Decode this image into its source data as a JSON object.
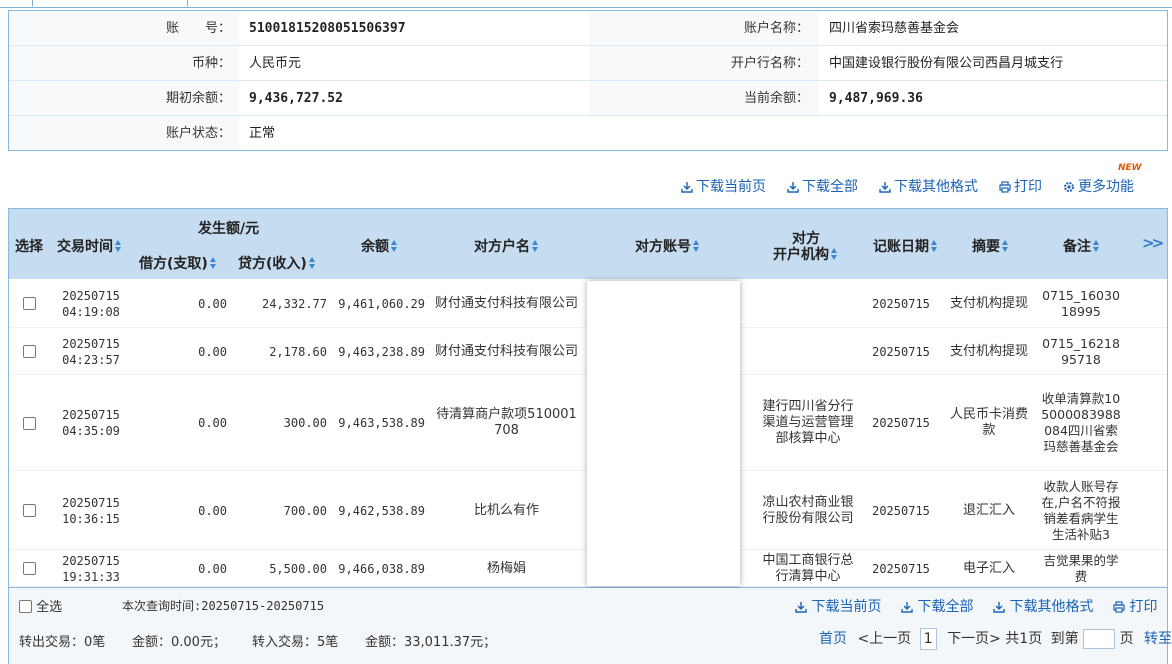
{
  "account_info": {
    "account_no_label": "账　　号：",
    "account_no": "510018152080515063 97",
    "account_name_label": "账户名称：",
    "account_name": "四川省索玛慈善基金会",
    "currency_label": "币种：",
    "currency": "人民币元",
    "bank_name_label": "开户行名称：",
    "bank_name": "中国建设银行股份有限公司西昌月城支行",
    "opening_balance_label": "期初余额：",
    "opening_balance": "9,436,727.52",
    "current_balance_label": "当前余额：",
    "current_balance": "9,487,969.36",
    "status_label": "账户状态：",
    "status": "正常"
  },
  "toolbar": {
    "new_badge": "NEW",
    "download_current": "下载当前页",
    "download_all": "下载全部",
    "download_other": "下载其他格式",
    "print": "打印",
    "more": "更多功能"
  },
  "table": {
    "headers": {
      "select": "选择",
      "time": "交易时间",
      "amount_group": "发生额/元",
      "debit": "借方(支取)",
      "credit": "贷方(收入)",
      "balance": "余额",
      "counterparty_name": "对方户名",
      "counterparty_account": "对方账号",
      "counterparty_bank_line1": "对方",
      "counterparty_bank_line2": "开户机构",
      "book_date": "记账日期",
      "summary": "摘要",
      "remark": "备注",
      "more": ">>"
    },
    "rows": [
      {
        "date": "20250715",
        "time": "04:19:08",
        "debit": "0.00",
        "credit": "24,332.77",
        "balance": "9,461,060.29",
        "name": "财付通支付科技有限公司",
        "bank": "",
        "book_date": "20250715",
        "summary": "支付机构提现",
        "remark": "0715_1603018995"
      },
      {
        "date": "20250715",
        "time": "04:23:57",
        "debit": "0.00",
        "credit": "2,178.60",
        "balance": "9,463,238.89",
        "name": "财付通支付科技有限公司",
        "bank": "",
        "book_date": "20250715",
        "summary": "支付机构提现",
        "remark": "0715_1621895718"
      },
      {
        "date": "20250715",
        "time": "04:35:09",
        "debit": "0.00",
        "credit": "300.00",
        "balance": "9,463,538.89",
        "name": "待清算商户款项510001708",
        "bank": "建行四川省分行渠道与运营管理部核算中心",
        "book_date": "20250715",
        "summary": "人民币卡消费款",
        "remark": "收单清算款105000083988084四川省索玛慈善基金会"
      },
      {
        "date": "20250715",
        "time": "10:36:15",
        "debit": "0.00",
        "credit": "700.00",
        "balance": "9,462,538.89",
        "name": "比机么有作",
        "bank": "凉山农村商业银行股份有限公司",
        "book_date": "20250715",
        "summary": "退汇汇入",
        "remark": "收款人账号存在,户名不符报销差看病学生生活补贴3"
      },
      {
        "date": "20250715",
        "time": "19:31:33",
        "debit": "0.00",
        "credit": "5,500.00",
        "balance": "9,466,038.89",
        "name": "杨梅娟",
        "bank": "中国工商银行总行清算中心",
        "book_date": "20250715",
        "summary": "电子汇入",
        "remark": "吉觉果果的学费"
      }
    ]
  },
  "footer": {
    "select_all": "全选",
    "query_time": "本次查询时间:20250715-20250715",
    "download_current": "下载当前页",
    "download_all": "下载全部",
    "download_other": "下载其他格式",
    "print": "打印",
    "out_tx": "转出交易：0笔",
    "out_amount": "金额：0.00元；",
    "in_tx": "转入交易：5笔",
    "in_amount": "金额：33,011.37元；",
    "first": "首页",
    "prev": "<上一页",
    "page": "1",
    "next": "下一页>",
    "total": "共1页",
    "goto": "到第",
    "page_unit": "页",
    "go": "转至"
  }
}
